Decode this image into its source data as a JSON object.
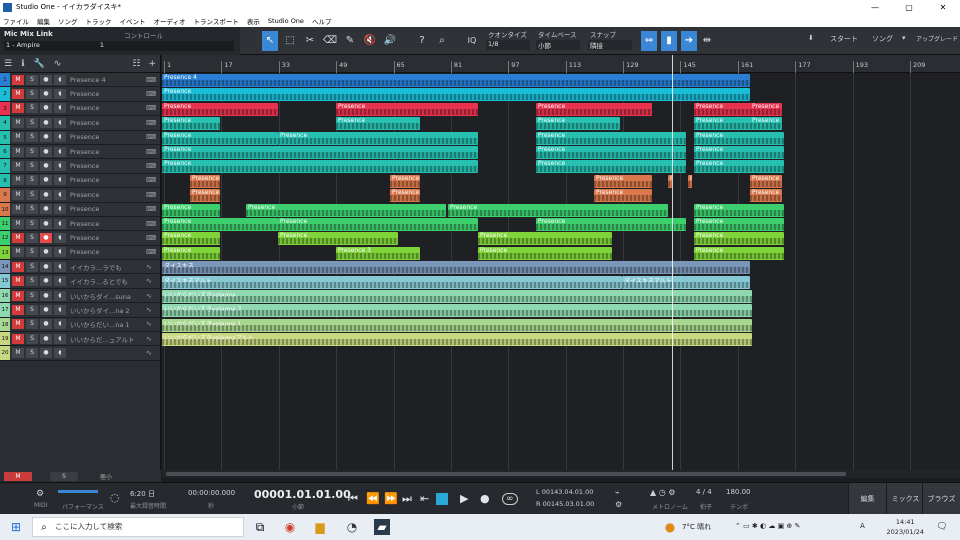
{
  "window": {
    "title": "Studio One - イイカラダイスキ*",
    "min": "—",
    "max": "▢",
    "close": "✕"
  },
  "menu": [
    "ファイル",
    "編集",
    "ソング",
    "トラック",
    "イベント",
    "オーディオ",
    "トランスポート",
    "表示",
    "Studio One",
    "ヘルプ"
  ],
  "toolbar": {
    "device": "Mic Mix Link",
    "control_label": "コントロール",
    "preset": "1 - Ampire",
    "preset_num": "1",
    "quantize_label": "クオンタイズ",
    "quantize_value": "1/8",
    "timebase_label": "タイムベース",
    "timebase_value": "小節",
    "snap_label": "スナップ",
    "snap_value": "隣接",
    "iq": "IQ",
    "start": "スタート",
    "song": "ソング",
    "upgrade": "アップグレード"
  },
  "ruler": [
    "1",
    "17",
    "33",
    "49",
    "65",
    "81",
    "97",
    "113",
    "129",
    "145",
    "161",
    "177",
    "193",
    "209"
  ],
  "tracks": [
    {
      "n": "1",
      "name": "Presence 4",
      "m": true,
      "type": "inst"
    },
    {
      "n": "2",
      "name": "Presence",
      "m": true,
      "type": "inst"
    },
    {
      "n": "3",
      "name": "Presence",
      "m": true,
      "type": "inst"
    },
    {
      "n": "4",
      "name": "Presence",
      "m": false,
      "type": "inst"
    },
    {
      "n": "5",
      "name": "Presence",
      "m": false,
      "type": "inst"
    },
    {
      "n": "6",
      "name": "Presence",
      "m": false,
      "type": "inst"
    },
    {
      "n": "7",
      "name": "Presence",
      "m": false,
      "type": "inst"
    },
    {
      "n": "8",
      "name": "Presence",
      "m": false,
      "type": "inst"
    },
    {
      "n": "9",
      "name": "Presence",
      "m": false,
      "type": "inst"
    },
    {
      "n": "10",
      "name": "Presence",
      "m": false,
      "type": "inst"
    },
    {
      "n": "11",
      "name": "Presence",
      "m": false,
      "type": "inst"
    },
    {
      "n": "12",
      "name": "Presence",
      "m": true,
      "type": "inst",
      "rec": true
    },
    {
      "n": "13",
      "name": "Presence",
      "m": false,
      "type": "inst"
    },
    {
      "n": "14",
      "name": "イイカラ...ラでも",
      "m": true,
      "type": "audio"
    },
    {
      "n": "15",
      "name": "イイカラ...るとでも",
      "m": true,
      "type": "audio"
    },
    {
      "n": "16",
      "name": "いいからダイ...suna",
      "m": true,
      "type": "audio"
    },
    {
      "n": "17",
      "name": "いいからダイ...na 2",
      "m": true,
      "type": "audio"
    },
    {
      "n": "18",
      "name": "いいからだい...na 1",
      "m": true,
      "type": "audio"
    },
    {
      "n": "19",
      "name": "いいからだ...ュアルト",
      "m": true,
      "type": "audio"
    },
    {
      "n": "20",
      "name": "",
      "m": false,
      "type": "audio"
    }
  ],
  "clip_labels": {
    "p4": "Presence 4",
    "p": "Presence",
    "p3": "Presence 3",
    "a14": "ダイスキネ",
    "a15": "ダイスキネアルト",
    "a15b": "ダイスキネアルト",
    "a16": "いいからだいすきvolaona",
    "a17": "いいからだいすきvolaona 2",
    "a18": "いいからだいすきvolaona 1",
    "a19": "いいからだいすきvolaonaアルト"
  },
  "colors": {
    "blue": "#2a7fd4",
    "cyan": "#1bbcd6",
    "red": "#e8324f",
    "teal": "#27c0b0",
    "orange": "#d9784c",
    "green": "#3dcf6e",
    "lime": "#7fd43a",
    "grayblue": "#7a96b8",
    "lightcyan": "#86c9d4",
    "mint": "#8fd8b0",
    "yellow": "#c8d880"
  },
  "footer": {
    "m": "M",
    "s": "S",
    "zoom": "極小"
  },
  "transport": {
    "midi": "MIDI",
    "perf": "パフォーマンス",
    "days": "6:20 日",
    "days_sub": "最大録音時間",
    "seconds": "00:00:00.000",
    "seconds_sub": "秒",
    "position": "00001.01.01.00",
    "position_sub": "小節",
    "loop_l": "L  00143.04.01.00",
    "loop_r": "R  00145.03.01.00",
    "metronome": "メトロノーム",
    "sig": "4 / 4",
    "sig_sub": "拍子",
    "tempo": "180.00",
    "tempo_sub": "テンポ",
    "edit": "編集",
    "mix": "ミックス",
    "browse": "ブラウズ"
  },
  "taskbar": {
    "search": "ここに入力して検索",
    "weather": "7°C 晴れ",
    "time": "14:41",
    "date": "2023/01/24",
    "ime": "A"
  }
}
